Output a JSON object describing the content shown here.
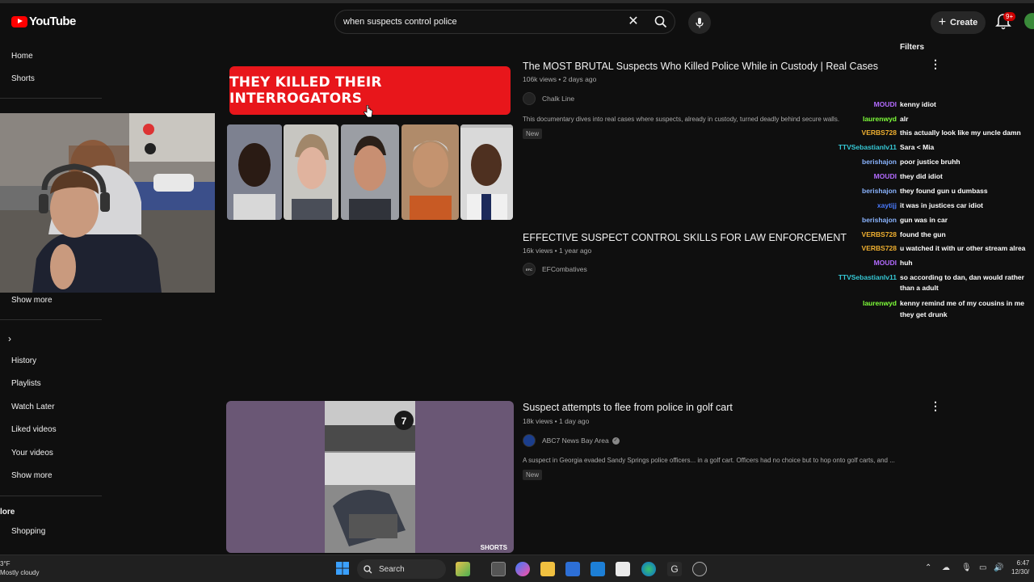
{
  "header": {
    "logo_text": "YouTube",
    "search_value": "when suspects control police",
    "create_label": "Create",
    "notification_count": "9+"
  },
  "sidebar": {
    "home": "Home",
    "shorts": "Shorts",
    "show_more_1": "Show more",
    "you_chevron": "›",
    "history": "History",
    "playlists": "Playlists",
    "watch_later": "Watch Later",
    "liked_videos": "Liked videos",
    "your_videos": "Your videos",
    "show_more_2": "Show more",
    "explore_section": "lore",
    "shopping": "Shopping"
  },
  "filters_label": "Filters",
  "videos": [
    {
      "thumbnail_text": "THEY KILLED THEIR INTERROGATORS",
      "title": "The MOST BRUTAL Suspects Who Killed Police While in Custody | Real Cases",
      "meta": "106k views • 2 days ago",
      "channel": "Chalk Line",
      "description": "This documentary dives into real cases where suspects, already in custody, turned deadly behind secure walls.",
      "badge": "New"
    },
    {
      "title": "EFFECTIVE SUSPECT CONTROL SKILLS FOR LAW ENFORCEMENT",
      "meta": "16k views • 1 year ago",
      "channel": "EFCombatives",
      "channel_avatar_text": "EFC"
    },
    {
      "title": "Suspect attempts to flee from police in golf cart",
      "meta": "18k views • 1 day ago",
      "channel": "ABC7 News Bay Area",
      "description": "A suspect in Georgia evaded Sandy Springs police officers... in a golf cart. Officers had no choice but to hop onto golf carts, and ...",
      "badge": "New",
      "shorts_label": "SHORTS"
    }
  ],
  "chat": [
    {
      "user": "MOUDI",
      "msg": "kenny idiot",
      "color": "#b36bff"
    },
    {
      "user": "laurenwyd",
      "msg": "alr",
      "color": "#7fff3a"
    },
    {
      "user": "VERBS728",
      "msg": "this actually look like my uncle damn",
      "color": "#f0b030"
    },
    {
      "user": "TTVSebastianlv11",
      "msg": "Sara < Mia",
      "color": "#36c9d6"
    },
    {
      "user": "berishajon",
      "msg": "poor justice bruhh",
      "color": "#8ab4ff"
    },
    {
      "user": "MOUDI",
      "msg": "they did idiot",
      "color": "#b36bff"
    },
    {
      "user": "berishajon",
      "msg": "they found gun u dumbass",
      "color": "#8ab4ff"
    },
    {
      "user": "xaytijj",
      "msg": "it was in justices car idiot",
      "color": "#4a7bff"
    },
    {
      "user": "berishajon",
      "msg": "gun was in car",
      "color": "#8ab4ff"
    },
    {
      "user": "VERBS728",
      "msg": "found the gun",
      "color": "#f0b030"
    },
    {
      "user": "VERBS728",
      "msg": "u watched it with ur other stream alrea",
      "color": "#f0b030"
    },
    {
      "user": "MOUDI",
      "msg": "huh",
      "color": "#b36bff"
    },
    {
      "user": "TTVSebastianlv11",
      "msg": "so according to dan, dan would rather",
      "color": "#36c9d6"
    },
    {
      "user": "",
      "msg": "than a adult",
      "color": "#36c9d6"
    },
    {
      "user": "laurenwyd",
      "msg": "kenny remind me of my cousins in me",
      "color": "#7fff3a"
    },
    {
      "user": "",
      "msg": "they get drunk",
      "color": "#7fff3a"
    }
  ],
  "taskbar": {
    "weather_temp": "3°F",
    "weather_desc": "Mostly cloudy",
    "search_label": "Search",
    "time": "6:47",
    "date": "12/30/"
  }
}
